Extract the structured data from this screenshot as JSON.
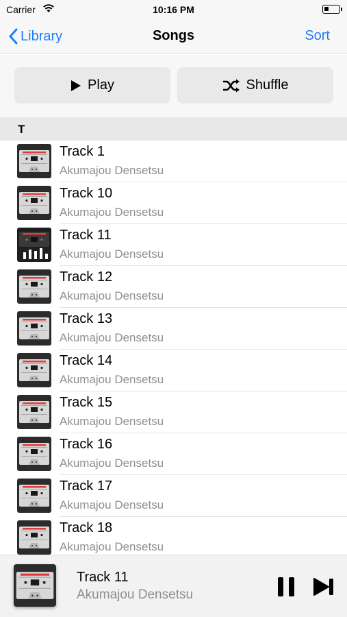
{
  "status_bar": {
    "carrier": "Carrier",
    "time": "10:16 PM"
  },
  "nav": {
    "back_label": "Library",
    "title": "Songs",
    "sort_label": "Sort"
  },
  "actions": {
    "play_label": "Play",
    "shuffle_label": "Shuffle"
  },
  "section": {
    "letter": "T"
  },
  "songs": [
    {
      "title": "Track 1",
      "artist": "Akumajou Densetsu",
      "art": "cassette-art"
    },
    {
      "title": "Track 10",
      "artist": "Akumajou Densetsu",
      "art": "cassette-art"
    },
    {
      "title": "Track 11",
      "artist": "Akumajou Densetsu",
      "art": "equalizer-art"
    },
    {
      "title": "Track 12",
      "artist": "Akumajou Densetsu",
      "art": "cassette-art"
    },
    {
      "title": "Track 13",
      "artist": "Akumajou Densetsu",
      "art": "cassette-art"
    },
    {
      "title": "Track 14",
      "artist": "Akumajou Densetsu",
      "art": "cassette-art"
    },
    {
      "title": "Track 15",
      "artist": "Akumajou Densetsu",
      "art": "cassette-art"
    },
    {
      "title": "Track 16",
      "artist": "Akumajou Densetsu",
      "art": "cassette-art"
    },
    {
      "title": "Track 17",
      "artist": "Akumajou Densetsu",
      "art": "cassette-art"
    },
    {
      "title": "Track 18",
      "artist": "Akumajou Densetsu",
      "art": "cassette-art"
    }
  ],
  "now_playing": {
    "title": "Track 11",
    "artist": "Akumajou Densetsu"
  },
  "colors": {
    "accent": "#1a7ff5",
    "secondary_text": "#8e8e93",
    "cassette_red": "#e03a3a"
  }
}
